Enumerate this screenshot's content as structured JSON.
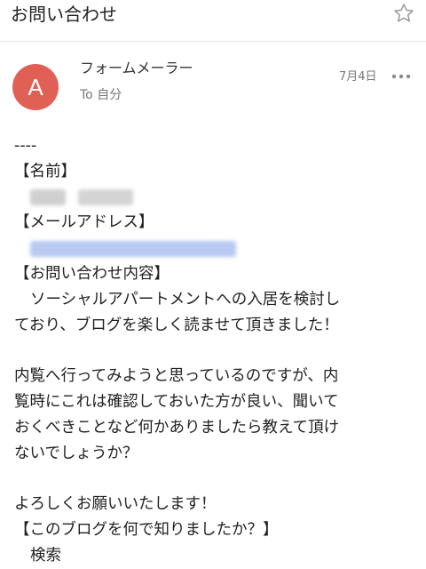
{
  "header": {
    "subject": "お問い合わせ",
    "star_icon": "star-outline-icon"
  },
  "message": {
    "avatar_letter": "A",
    "avatar_color": "#e06055",
    "sender_name": "フォームメーラー",
    "recipient": "To 自分",
    "date": "7月4日",
    "more_icon": "more-horizontal-icon"
  },
  "body": {
    "separator": "----",
    "name_label": "【名前】",
    "email_label": "【メールアドレス】",
    "inquiry_label": "【お問い合わせ内容】",
    "paragraph1_line1": "ソーシャルアパートメントへの入居を検討し",
    "paragraph1_line2": "ており、ブログを楽しく読ませて頂きました！",
    "paragraph2_line1": "内覧へ行ってみようと思っているのですが、内",
    "paragraph2_line2": "覧時にこれは確認しておいた方が良い、聞いて",
    "paragraph2_line3": "おくべきことなど何かありましたら教えて頂け",
    "paragraph2_line4": "ないでしょうか？",
    "closing": "よろしくお願いいたします！",
    "source_label": "【このブログを何で知りましたか？】",
    "source_answer": "検索"
  }
}
